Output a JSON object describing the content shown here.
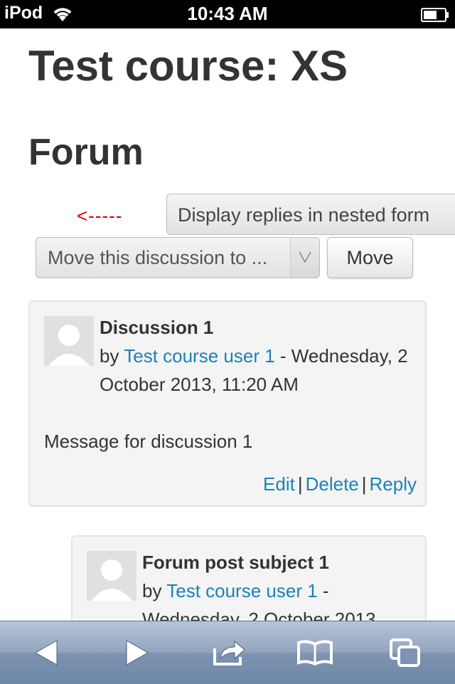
{
  "status_bar": {
    "carrier": "iPod",
    "time": "10:43 AM"
  },
  "page": {
    "course_title": "Test course: XS",
    "forum_heading": "Forum",
    "arrow_indicator": "<-----",
    "display_mode_select": "Display replies in nested form",
    "move_select": "Move this discussion to ...",
    "move_button": "Move"
  },
  "posts": [
    {
      "subject": "Discussion 1",
      "by_label": "by",
      "author": "Test course user 1",
      "date_sep": " -",
      "date": "Wednesday, 2 October 2013, 11:20 AM",
      "message": "Message for discussion 1",
      "actions": {
        "edit": "Edit",
        "delete": "Delete",
        "reply": "Reply"
      }
    },
    {
      "subject": "Forum post subject 1",
      "by_label": "by",
      "author": "Test course user 1",
      "date_sep": " -",
      "date": "Wednesday, 2 October 2013"
    }
  ],
  "toolbar": {
    "back_icon": "back-arrow-icon",
    "forward_icon": "forward-arrow-icon",
    "share_icon": "share-icon",
    "bookmarks_icon": "bookmarks-icon",
    "tabs_icon": "tabs-icon"
  },
  "colors": {
    "link": "#1a83b8",
    "arrow": "#d40000"
  }
}
